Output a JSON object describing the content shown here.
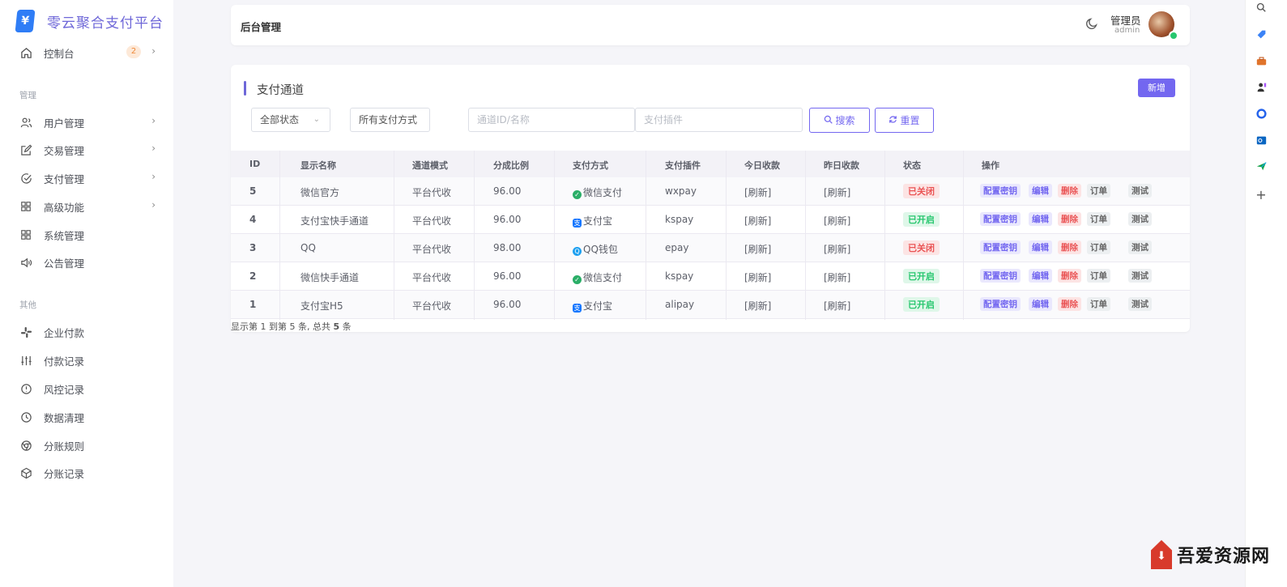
{
  "brand": {
    "logo": "¥",
    "title": "零云聚合支付平台"
  },
  "sidebar": {
    "top": [
      {
        "label": "控制台",
        "icon": "home-icon",
        "badge": "2"
      }
    ],
    "section_manage": "管理",
    "manage": [
      {
        "label": "用户管理",
        "icon": "users-icon"
      },
      {
        "label": "交易管理",
        "icon": "edit-icon"
      },
      {
        "label": "支付管理",
        "icon": "check-circle-icon"
      },
      {
        "label": "高级功能",
        "icon": "grid-icon"
      },
      {
        "label": "系统管理",
        "icon": "grid-icon"
      },
      {
        "label": "公告管理",
        "icon": "speaker-icon"
      }
    ],
    "section_other": "其他",
    "other": [
      {
        "label": "企业付款",
        "icon": "slack-icon"
      },
      {
        "label": "付款记录",
        "icon": "sliders-icon"
      },
      {
        "label": "风控记录",
        "icon": "alert-circle-icon"
      },
      {
        "label": "数据清理",
        "icon": "clock-icon"
      },
      {
        "label": "分账规则",
        "icon": "chrome-icon"
      },
      {
        "label": "分账记录",
        "icon": "codesandbox-icon"
      }
    ]
  },
  "topbar": {
    "title": "后台管理",
    "user_name": "管理员",
    "user_role": "admin"
  },
  "card": {
    "title": "支付通道",
    "new_button": "新增",
    "filters": {
      "status_select": "全部状态",
      "type_select": "所有支付方式",
      "channel_placeholder": "通道ID/名称",
      "plugin_placeholder": "支付插件",
      "search_button": "搜索",
      "reset_button": "重置"
    }
  },
  "table": {
    "headers": [
      "ID",
      "显示名称",
      "通道模式",
      "分成比例",
      "支付方式",
      "支付插件",
      "今日收款",
      "昨日收款",
      "状态",
      "操作"
    ],
    "actions": [
      "配置密钥",
      "编辑",
      "删除",
      "订单",
      "测试"
    ],
    "rows": [
      {
        "id": "5",
        "name": "微信官方",
        "mode": "平台代收",
        "ratio": "96.00",
        "pay": "微信支付",
        "pay_icon": "wechat-icon",
        "plugin": "wxpay",
        "today": "[刷新]",
        "yesterday": "[刷新]",
        "status": "已关闭",
        "status_on": false
      },
      {
        "id": "4",
        "name": "支付宝快手通道",
        "mode": "平台代收",
        "ratio": "96.00",
        "pay": "支付宝",
        "pay_icon": "alipay-icon",
        "plugin": "kspay",
        "today": "[刷新]",
        "yesterday": "[刷新]",
        "status": "已开启",
        "status_on": true
      },
      {
        "id": "3",
        "name": "QQ",
        "mode": "平台代收",
        "ratio": "98.00",
        "pay": "QQ钱包",
        "pay_icon": "qq-icon",
        "plugin": "epay",
        "today": "[刷新]",
        "yesterday": "[刷新]",
        "status": "已关闭",
        "status_on": false
      },
      {
        "id": "2",
        "name": "微信快手通道",
        "mode": "平台代收",
        "ratio": "96.00",
        "pay": "微信支付",
        "pay_icon": "wechat-icon",
        "plugin": "kspay",
        "today": "[刷新]",
        "yesterday": "[刷新]",
        "status": "已开启",
        "status_on": true
      },
      {
        "id": "1",
        "name": "支付宝H5",
        "mode": "平台代收",
        "ratio": "96.00",
        "pay": "支付宝",
        "pay_icon": "alipay-icon",
        "plugin": "alipay",
        "today": "[刷新]",
        "yesterday": "[刷新]",
        "status": "已开启",
        "status_on": true
      }
    ],
    "footer_prefix": "显示第 1 到第 5 条, 总共 ",
    "footer_total": "5",
    "footer_suffix": " 条"
  },
  "watermark": {
    "text": "吾爱资源网"
  },
  "colors": {
    "accent": "#7367f0",
    "danger": "#ea5455",
    "success": "#28c76f"
  }
}
